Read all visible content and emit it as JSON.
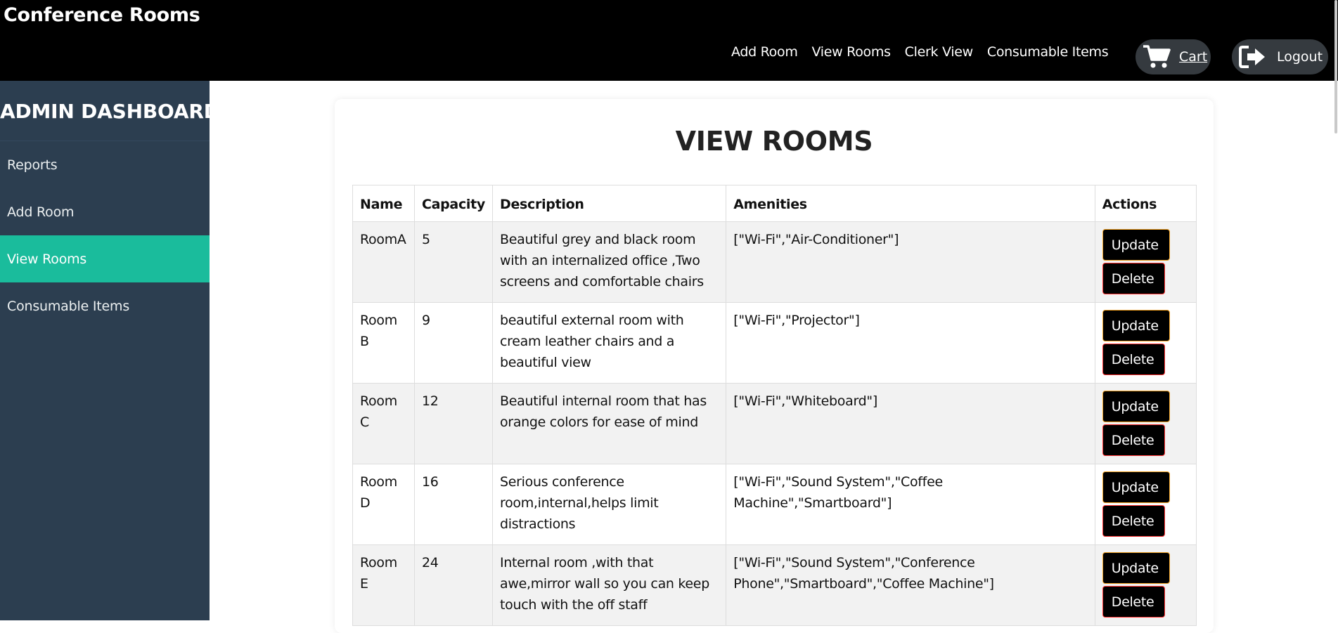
{
  "header": {
    "title": "Conference Rooms",
    "nav": [
      "Add Room",
      "View Rooms",
      "Clerk View",
      "Consumable Items"
    ],
    "cart_label": "Cart",
    "logout_label": "Logout"
  },
  "sidebar": {
    "title": "ADMIN DASHBOARD",
    "items": [
      {
        "label": "Reports",
        "active": false
      },
      {
        "label": "Add Room",
        "active": false
      },
      {
        "label": "View Rooms",
        "active": true
      },
      {
        "label": "Consumable Items",
        "active": false
      }
    ],
    "active_color": "#1abc9c",
    "bg_color": "#2c3e50"
  },
  "main": {
    "title": "VIEW ROOMS",
    "columns": [
      "Name",
      "Capacity",
      "Description",
      "Amenities",
      "Actions"
    ],
    "update_label": "Update",
    "delete_label": "Delete",
    "rows": [
      {
        "name": "RoomA",
        "capacity": "5",
        "description": "Beautiful grey and black room with an internalized office ,Two screens and comfortable chairs",
        "amenities": "[\"Wi-Fi\",\"Air-Conditioner\"]"
      },
      {
        "name": "Room B",
        "capacity": "9",
        "description": "beautiful external room with cream leather chairs and a beautiful view",
        "amenities": "[\"Wi-Fi\",\"Projector\"]"
      },
      {
        "name": "Room C",
        "capacity": "12",
        "description": "Beautiful internal room that has orange colors for ease of mind",
        "amenities": "[\"Wi-Fi\",\"Whiteboard\"]"
      },
      {
        "name": "Room D",
        "capacity": "16",
        "description": "Serious conference room,internal,helps limit distractions",
        "amenities": "[\"Wi-Fi\",\"Sound System\",\"Coffee Machine\",\"Smartboard\"]"
      },
      {
        "name": "Room E",
        "capacity": "24",
        "description": "Internal room ,with that awe,mirror wall so you can keep touch with the off staff",
        "amenities": "[\"Wi-Fi\",\"Sound System\",\"Conference Phone\",\"Smartboard\",\"Coffee Machine\"]"
      }
    ]
  }
}
